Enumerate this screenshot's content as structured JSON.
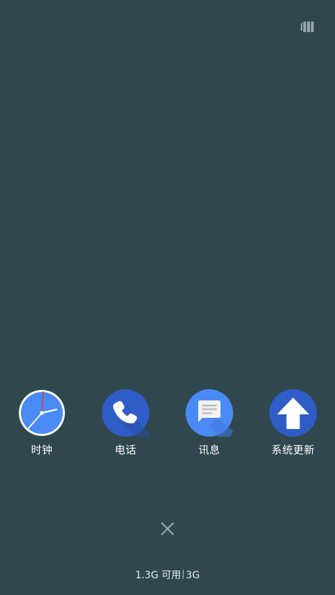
{
  "screen": {
    "background_color": "#30474d"
  },
  "top_right": {
    "icon": "recent-apps-stack-icon"
  },
  "dock": {
    "apps": [
      {
        "label": "时钟",
        "icon": "clock-icon",
        "color": "#4a8af4"
      },
      {
        "label": "电话",
        "icon": "phone-icon",
        "color": "#2f5cc6"
      },
      {
        "label": "讯息",
        "icon": "messages-icon",
        "color": "#4a8af4"
      },
      {
        "label": "系统更新",
        "icon": "system-update-icon",
        "color": "#2f5cc6"
      }
    ]
  },
  "controls": {
    "close_icon": "close-icon"
  },
  "memory_info": {
    "available": "1.3G 可用",
    "total": "3G"
  }
}
